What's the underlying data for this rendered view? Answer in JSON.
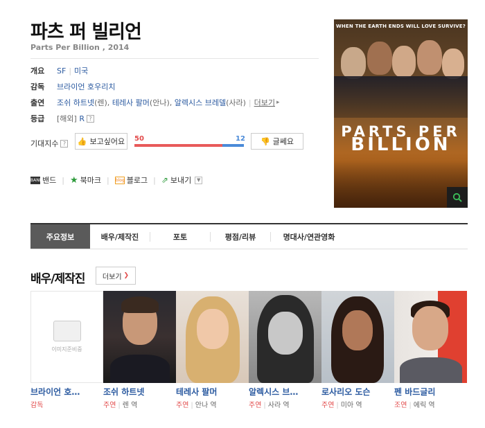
{
  "movie": {
    "title": "파츠 퍼 빌리언",
    "subtitle": "Parts Per Billion , 2014"
  },
  "info": {
    "overview_label": "개요",
    "genre": "SF",
    "country": "미국",
    "director_label": "감독",
    "director": "브라이언 호우리치",
    "cast_label": "출연",
    "cast_1": "조쉬 하트넷",
    "cast_1_role": "(렌),",
    "cast_2": "테레사 팔머",
    "cast_2_role": "(안나),",
    "cast_3": "알렉시스 브레델",
    "cast_3_role": "(사라)",
    "cast_more": "더보기",
    "rating_label": "등급",
    "rating_overseas": "[해외]",
    "rating": "R",
    "rating_help": "?"
  },
  "expectation": {
    "label": "기대지수",
    "help": "?",
    "want_button": "보고싶어요",
    "nope_button": "글쎄요",
    "want_count": "50",
    "nope_count": "12",
    "want_fraction": 0.806
  },
  "share": {
    "band_icon_text": "BAND",
    "band": "밴드",
    "bookmark": "북마크",
    "blog_icon_text": "blog",
    "blog": "블로그",
    "send": "보내기"
  },
  "poster": {
    "tagline": "WHEN THE EARTH ENDS WILL LOVE SURVIVE?",
    "title_line1": "PARTS PER",
    "title_line2": "BILLION"
  },
  "tabs": [
    {
      "label": "주요정보"
    },
    {
      "label": "배우/제작진"
    },
    {
      "label": "포토"
    },
    {
      "label": "평점/리뷰"
    },
    {
      "label": "명대사/연관영화"
    }
  ],
  "crew_section": {
    "title": "배우/제작진",
    "more": "더보기",
    "no_image": "이미지준비중"
  },
  "crew": [
    {
      "name": "브라이언 호…",
      "type": "감독",
      "role": ""
    },
    {
      "name": "조쉬 하트넷",
      "type": "주연",
      "role": "렌 역"
    },
    {
      "name": "테레사 팔머",
      "type": "주연",
      "role": "안나 역"
    },
    {
      "name": "알렉시스 브…",
      "type": "주연",
      "role": "사라 역"
    },
    {
      "name": "로사리오 도슨",
      "type": "주연",
      "role": "미아 역"
    },
    {
      "name": "펜 바드글리",
      "type": "조연",
      "role": "에릭 역"
    }
  ],
  "colors": {
    "link": "#2b5aa0",
    "want": "#e85a5a",
    "nope": "#4a8ad8",
    "active_tab": "#5a5a5a"
  }
}
